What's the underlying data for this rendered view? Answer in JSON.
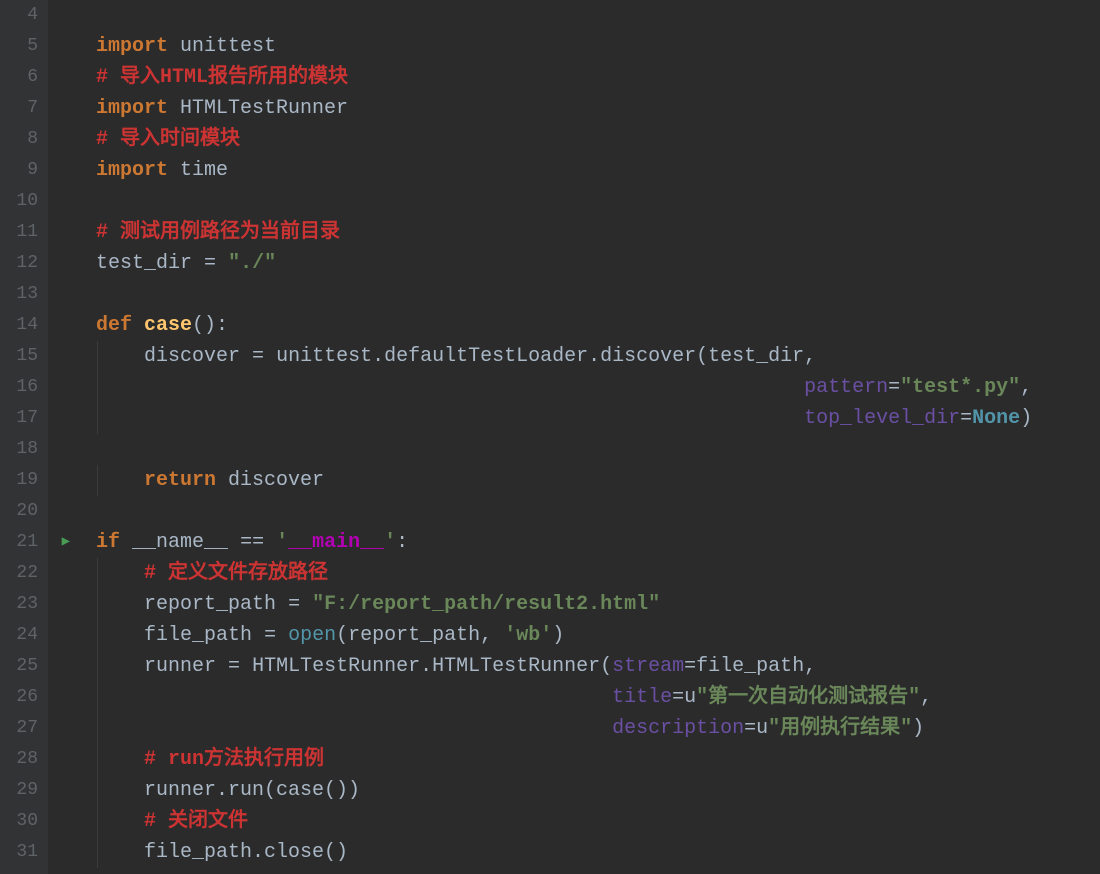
{
  "lines": [
    {
      "n": 4,
      "indent": 0,
      "html": ""
    },
    {
      "n": 5,
      "indent": 0,
      "html": "<span class='tok-kw'>import</span> <span class='tok-ident'>unittest</span>"
    },
    {
      "n": 6,
      "indent": 0,
      "html": "<span class='tok-comment'># 导入HTML报告所用的模块</span>"
    },
    {
      "n": 7,
      "indent": 0,
      "html": "<span class='tok-kw'>import</span> <span class='tok-ident'>HTMLTestRunner</span>"
    },
    {
      "n": 8,
      "indent": 0,
      "html": "<span class='tok-comment'># 导入时间模块</span>"
    },
    {
      "n": 9,
      "indent": 0,
      "html": "<span class='tok-kw'>import</span> <span class='tok-ident'>time</span>"
    },
    {
      "n": 10,
      "indent": 0,
      "html": ""
    },
    {
      "n": 11,
      "indent": 0,
      "html": "<span class='tok-comment'># 测试用例路径为当前目录</span>"
    },
    {
      "n": 12,
      "indent": 0,
      "html": "<span class='tok-ident'>test_dir</span> <span class='tok-op'>=</span> <span class='tok-str'>\"./\"</span>"
    },
    {
      "n": 13,
      "indent": 0,
      "html": ""
    },
    {
      "n": 14,
      "indent": 0,
      "html": "<span class='tok-kw'>def</span> <span class='tok-func'>case</span><span class='tok-op'>():</span>"
    },
    {
      "n": 15,
      "indent": 1,
      "html": "<span class='tok-ident'>discover</span> <span class='tok-op'>=</span> <span class='tok-ident'>unittest.defaultTestLoader.discover(test_dir,</span>"
    },
    {
      "n": 16,
      "indent": 1,
      "html": "                                                       <span class='tok-arg'>pattern</span><span class='tok-op'>=</span><span class='tok-str'>\"test*.py\"</span><span class='tok-op'>,</span>"
    },
    {
      "n": 17,
      "indent": 1,
      "html": "                                                       <span class='tok-arg'>top_level_dir</span><span class='tok-op'>=</span><span class='tok-none'>None</span><span class='tok-op'>)</span>"
    },
    {
      "n": 18,
      "indent": 0,
      "html": ""
    },
    {
      "n": 19,
      "indent": 1,
      "html": "<span class='tok-kw'>return</span> <span class='tok-ident'>discover</span>"
    },
    {
      "n": 20,
      "indent": 0,
      "html": ""
    },
    {
      "n": 21,
      "indent": 0,
      "run": true,
      "html": "<span class='tok-kw'>if</span> <span class='tok-ident'>__name__</span> <span class='tok-op'>==</span> <span class='tok-str'>'</span><span class='tok-special'>__main__</span><span class='tok-str'>'</span><span class='tok-op'>:</span>"
    },
    {
      "n": 22,
      "indent": 1,
      "html": "<span class='tok-comment'># 定义文件存放路径</span>"
    },
    {
      "n": 23,
      "indent": 1,
      "html": "<span class='tok-ident'>report_path</span> <span class='tok-op'>=</span> <span class='tok-str'>\"F:/report_path/result2.html\"</span>"
    },
    {
      "n": 24,
      "indent": 1,
      "html": "<span class='tok-ident'>file_path</span> <span class='tok-op'>=</span> <span class='tok-builtin'>open</span><span class='tok-op'>(</span><span class='tok-ident'>report_path</span><span class='tok-op'>,</span> <span class='tok-str'>'wb'</span><span class='tok-op'>)</span>"
    },
    {
      "n": 25,
      "indent": 1,
      "html": "<span class='tok-ident'>runner</span> <span class='tok-op'>=</span> <span class='tok-ident'>HTMLTestRunner.HTMLTestRunner(</span><span class='tok-arg'>stream</span><span class='tok-op'>=</span><span class='tok-ident'>file_path,</span>"
    },
    {
      "n": 26,
      "indent": 1,
      "html": "                                       <span class='tok-arg'>title</span><span class='tok-op'>=</span><span class='tok-upfx'>u</span><span class='tok-str'>\"第一次自动化测试报告\"</span><span class='tok-op'>,</span>"
    },
    {
      "n": 27,
      "indent": 1,
      "html": "                                       <span class='tok-arg'>description</span><span class='tok-op'>=</span><span class='tok-upfx'>u</span><span class='tok-str'>\"用例执行结果\"</span><span class='tok-op'>)</span>"
    },
    {
      "n": 28,
      "indent": 1,
      "html": "<span class='tok-comment'># run方法执行用例</span>"
    },
    {
      "n": 29,
      "indent": 1,
      "html": "<span class='tok-ident'>runner.run(case())</span>"
    },
    {
      "n": 30,
      "indent": 1,
      "html": "<span class='tok-comment'># 关闭文件</span>"
    },
    {
      "n": 31,
      "indent": 1,
      "html": "<span class='tok-ident'>file_path.close()</span>"
    }
  ],
  "indent_unit": "    "
}
